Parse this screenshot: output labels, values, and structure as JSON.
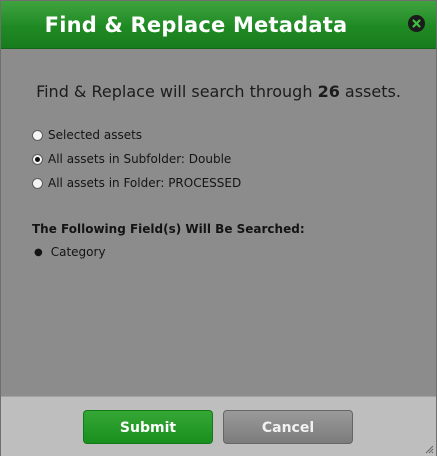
{
  "dialog": {
    "title": "Find & Replace Metadata",
    "close_icon": "close-icon"
  },
  "summary": {
    "prefix": "Find & Replace will search through ",
    "count": "26",
    "suffix": " assets."
  },
  "scope_options": [
    {
      "label": "Selected assets",
      "checked": false
    },
    {
      "label": "All assets in Subfolder: Double",
      "checked": true
    },
    {
      "label": "All assets in Folder: PROCESSED",
      "checked": false
    }
  ],
  "fields": {
    "heading": "The Following Field(s) Will Be Searched:",
    "items": [
      "Category"
    ]
  },
  "buttons": {
    "submit": "Submit",
    "cancel": "Cancel"
  },
  "colors": {
    "title_bar": "#1f8a24",
    "submit": "#198f1f",
    "cancel": "#8a8a8a",
    "body": "#8c8c8c",
    "footer": "#bebebe"
  }
}
